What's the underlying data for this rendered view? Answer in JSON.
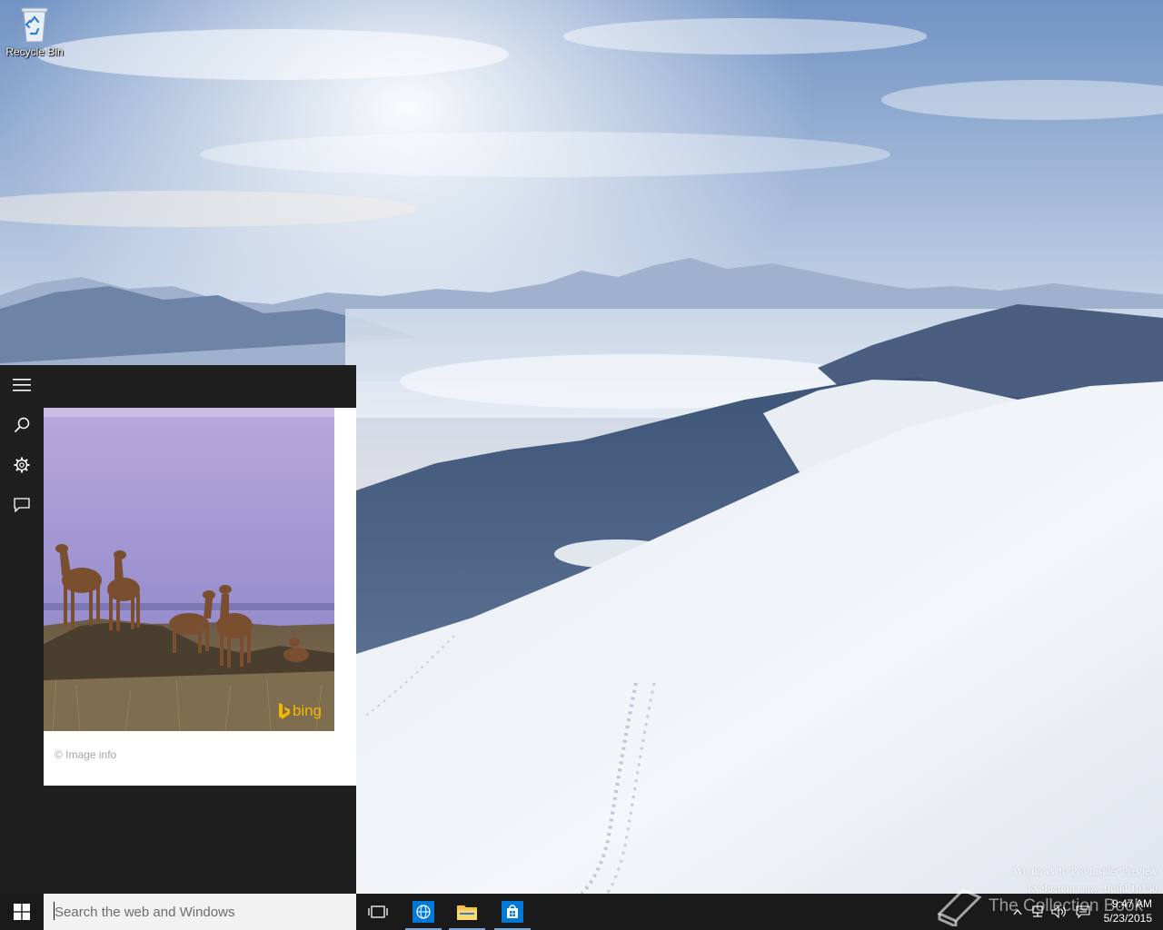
{
  "desktop": {
    "icons": [
      {
        "label": "Recycle Bin",
        "icon": "recycle-bin-icon"
      }
    ]
  },
  "cortana": {
    "rail": [
      {
        "name": "hamburger-menu",
        "icon": "hamburger-icon"
      },
      {
        "name": "search",
        "icon": "search-icon"
      },
      {
        "name": "settings",
        "icon": "gear-icon"
      },
      {
        "name": "feedback",
        "icon": "feedback-icon"
      }
    ],
    "card": {
      "image_subject": "deer-herd-photo",
      "bing_label": "bing",
      "image_info": "© Image info"
    }
  },
  "watermark": {
    "line1": "Windows 10 Pro Insider Preview",
    "line2": "Evaluation copy. Build 10130"
  },
  "overlay_logo": {
    "text": "The Collection Book"
  },
  "taskbar": {
    "search_placeholder": "Search the web and Windows",
    "apps": [
      {
        "name": "task-view",
        "icon": "task-view-icon"
      },
      {
        "name": "edge",
        "icon": "globe-icon"
      },
      {
        "name": "file-explorer",
        "icon": "folder-icon"
      },
      {
        "name": "store",
        "icon": "store-icon"
      }
    ],
    "tray_icons": [
      "chevron-up-icon",
      "network-icon",
      "volume-icon",
      "action-center-icon"
    ],
    "clock": {
      "time": "9:47 AM",
      "date": "5/23/2015"
    }
  },
  "colors": {
    "taskbar": "#1a1a1a",
    "cortana_bg": "#1f1f1f",
    "accent": "#0078d7",
    "bing": "#f2b600"
  }
}
